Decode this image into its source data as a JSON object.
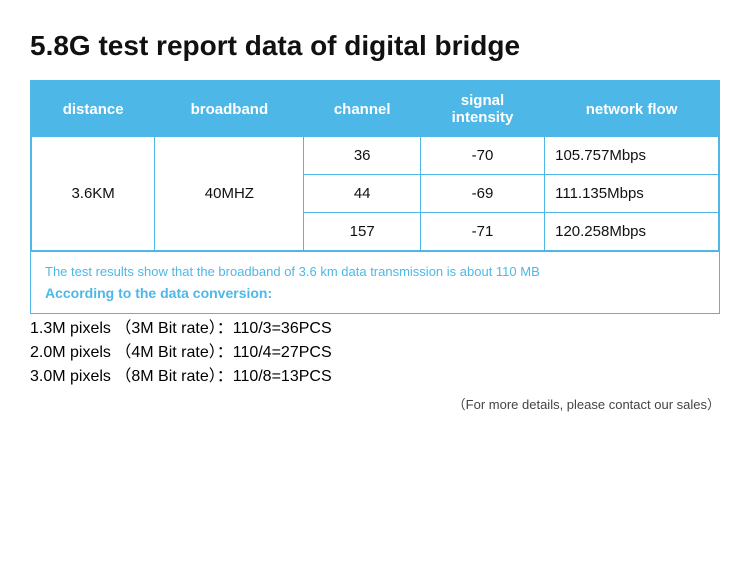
{
  "title": "5.8G test report data of digital bridge",
  "table": {
    "headers": [
      "distance",
      "broadband",
      "channel",
      "signal\nintensity",
      "network flow"
    ],
    "rows": [
      {
        "distance": "3.6KM",
        "broadband": "40MHZ",
        "channel": "36",
        "signal": "-70",
        "flow": "105.757Mbps"
      },
      {
        "distance": "",
        "broadband": "",
        "channel": "44",
        "signal": "-69",
        "flow": "111.135Mbps"
      },
      {
        "distance": "",
        "broadband": "",
        "channel": "157",
        "signal": "-71",
        "flow": "120.258Mbps"
      }
    ]
  },
  "info": {
    "note": "The test results show that the broadband of 3.6 km data transmission is about 110 MB",
    "conversion_label": "According to the data conversion:"
  },
  "pixel_rows": [
    "1.3M pixels （3M Bit rate）：110/3=36PCS",
    "2.0M pixels （4M Bit rate）：110/4=27PCS",
    "3.0M pixels （8M Bit rate）：110/8=13PCS"
  ],
  "footnote": "（For more details, please contact our sales）"
}
